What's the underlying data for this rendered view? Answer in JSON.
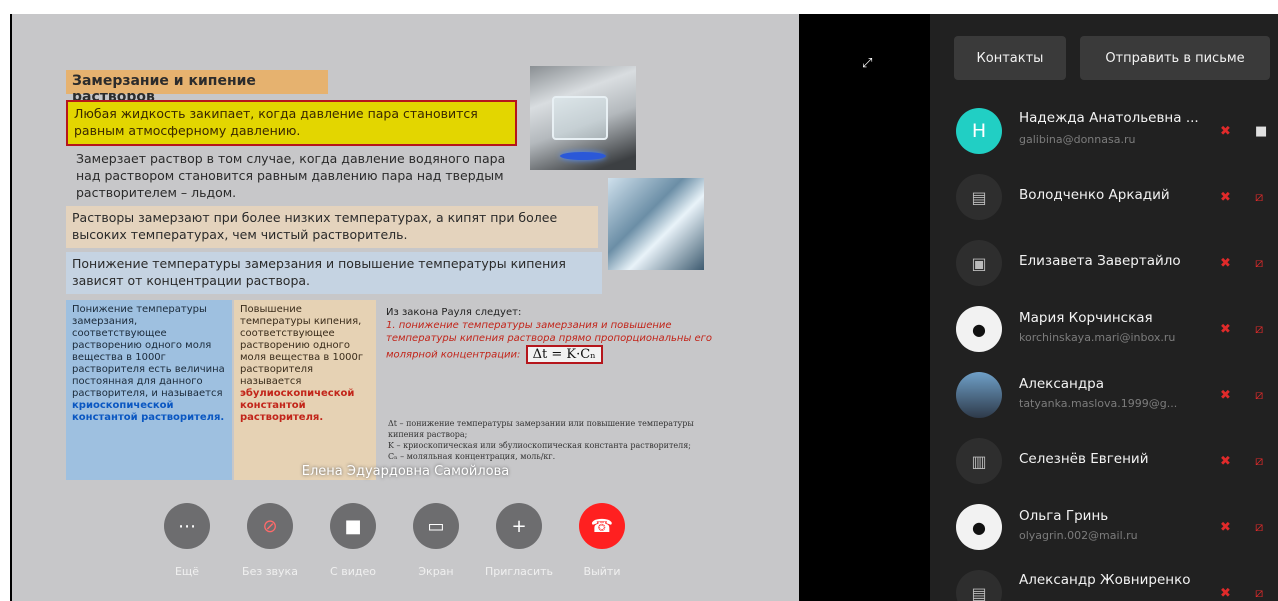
{
  "slide": {
    "title": "Замерзание и кипение растворов",
    "definition": "Любая жидкость закипает, когда давление пара становится равным атмосферному давлению.",
    "p1": "Замерзает раствор в том случае, когда давление водяного пара над раствором становится равным давлению пара над твердым растворителем – льдом.",
    "p2": "Растворы замерзают при более низких температурах, а кипят при более высоких температурах, чем чистый растворитель.",
    "p3": "Понижение температуры замерзания и повышение температуры кипения зависят от концентрации раствора.",
    "col1_text": "Понижение температуры замерзания, соответствующее растворению одного моля вещества в 1000г растворителя есть величина постоянная для данного растворителя, и называется",
    "col1_highlight": "криоскопической константой растворителя.",
    "col2_text": "Повышение температуры кипения, соответствующее растворению одного моля вещества в 1000г растворителя называется",
    "col2_highlight": "эбулиоскопической константой растворителя.",
    "raoult_intro": "Из закона Рауля следует:",
    "raoult_red": "1. понижение температуры замерзания и повышение температуры кипения раствора прямо пропорциональны его молярной концентрации:",
    "formula": "Δt = K·Cₙ",
    "legend_1": "Δt – понижение температуры замерзании или повышение температуры кипения раствора;",
    "legend_2": "K – криоскопическая или эбулиоскопическая константа растворителя;",
    "legend_3": "Cₙ – моляльная концентрация, моль/кг."
  },
  "speaker_name": "Елена Эдуардовна Самойлова",
  "controls": [
    {
      "label": "Ещё",
      "icon": "more-icon"
    },
    {
      "label": "Без звука",
      "icon": "mic-off-icon"
    },
    {
      "label": "С видео",
      "icon": "camera-icon"
    },
    {
      "label": "Экран",
      "icon": "screen-share-icon"
    },
    {
      "label": "Пригласить",
      "icon": "plus-icon"
    },
    {
      "label": "Выйти",
      "icon": "hang-up-icon"
    }
  ],
  "panel": {
    "contacts_button": "Контакты",
    "send_button": "Отправить в письме",
    "participants": [
      {
        "name": "Надежда Анатольевна ...",
        "email": "galibina@donnasa.ru",
        "avatar": "Н"
      },
      {
        "name": "Володченко Аркадий",
        "email": "",
        "avatar": ""
      },
      {
        "name": "Елизавета Завертайло",
        "email": "",
        "avatar": ""
      },
      {
        "name": "Мария Корчинская",
        "email": "korchinskaya.mari@inbox.ru",
        "avatar": ""
      },
      {
        "name": "Александра",
        "email": "tatyanka.maslova.1999@g...",
        "avatar": ""
      },
      {
        "name": "Селезнёв Евгений",
        "email": "",
        "avatar": ""
      },
      {
        "name": "Ольга Гринь",
        "email": "olyagrin.002@mail.ru",
        "avatar": ""
      },
      {
        "name": "Александр Жовниренко",
        "email": "",
        "avatar": ""
      }
    ]
  },
  "colors": {
    "accent_teal": "#21cfc4",
    "danger": "#ff2020",
    "panel_bg": "#212121"
  }
}
